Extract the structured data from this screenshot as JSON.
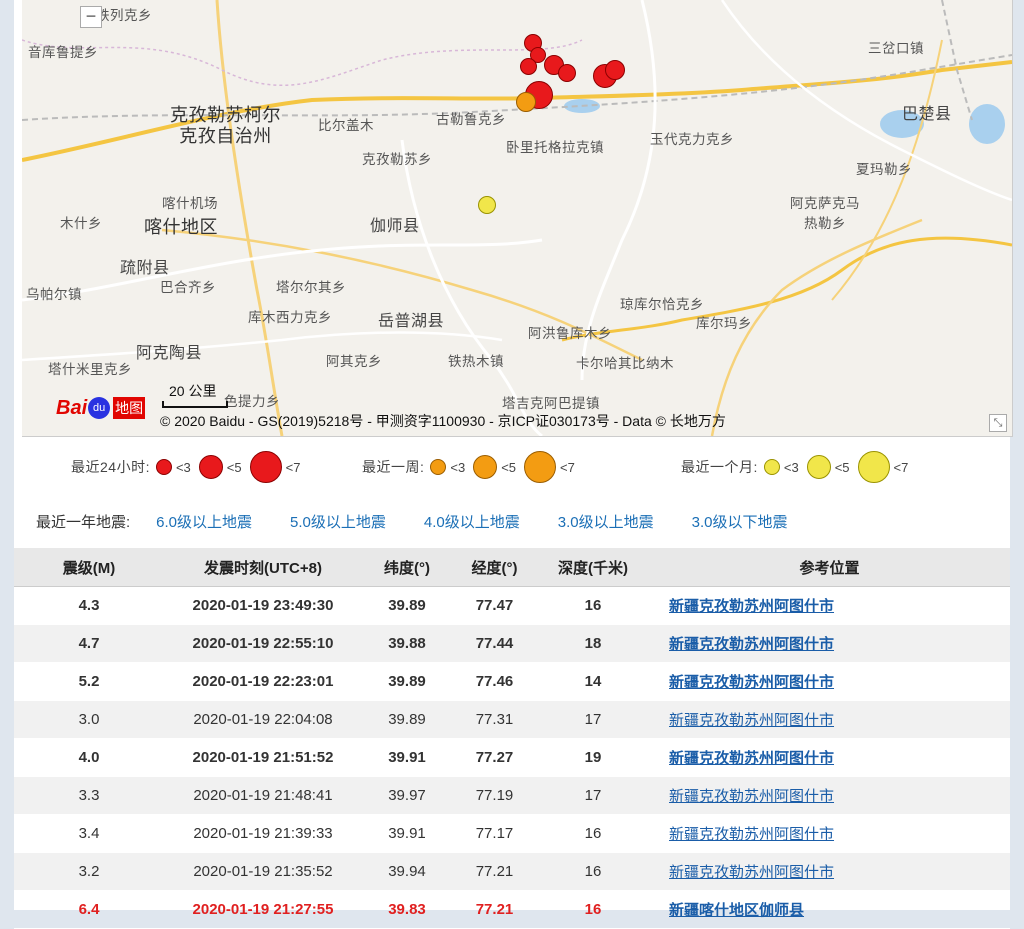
{
  "map": {
    "places": {
      "tieliekexiang": "铁列克乡",
      "yinkulutixiang": "音库鲁提乡",
      "kezhou_line1": "克孜勒苏柯尔",
      "kezhou_line2": "克孜自治州",
      "bierkaimu": "比尔盖木",
      "gulelukexiang": "古勒鲁克乡",
      "woli": "卧里托格拉克镇",
      "yudaikeli": "玉代克力克乡",
      "sanchakou": "三岔口镇",
      "bachu": "巴楚县",
      "kezilesu_xiang": "克孜勒苏乡",
      "xiamaleixiang": "夏玛勒乡",
      "kashijichang": "喀什机场",
      "mushixiang": "木什乡",
      "kashi": "喀什地区",
      "jiashi": "伽师县",
      "akesakema_line1": "阿克萨克马",
      "akesakema_line2": "热勒乡",
      "shufu": "疏附县",
      "bahezi": "巴合齐乡",
      "taerqi": "塔尔尔其乡",
      "wupaer": "乌帕尔镇",
      "qiongkuer": "琼库尔恰克乡",
      "kumuxi": "库木西力克乡",
      "yuepuhu": "岳普湖县",
      "akhonglu": "阿洪鲁库木乡",
      "kuermaxiang": "库尔玛乡",
      "akeaotao": "阿克陶县",
      "aqikexiang": "阿其克乡",
      "tiereimu": "铁热木镇",
      "kaerhaqi": "卡尔哈其比纳木",
      "tashimili": "塔什米里克乡",
      "selikexiang": "色提力乡",
      "tajiabati": "塔吉克阿巴提镇"
    },
    "scale_label": "20 公里",
    "logo_text": "Bai",
    "logo_paw": "du",
    "logo_map": "地图",
    "copyright": "© 2020 Baidu - GS(2019)5218号 - 甲测资字1100930 - 京ICP证030173号 - Data © 长地万方",
    "zoom_out": "−",
    "resize_glyph": "⤡"
  },
  "legend": {
    "day": {
      "title": "最近24小时:",
      "items": [
        "<3",
        "<5",
        "<7"
      ],
      "color": "#e8191c"
    },
    "week": {
      "title": "最近一周:",
      "items": [
        "<3",
        "<5",
        "<7"
      ],
      "color": "#f39c12"
    },
    "month": {
      "title": "最近一个月:",
      "items": [
        "<3",
        "<5",
        "<7"
      ],
      "color": "#f1e64a"
    }
  },
  "filters": {
    "label": "最近一年地震:",
    "links": [
      "6.0级以上地震",
      "5.0级以上地震",
      "4.0级以上地震",
      "3.0级以上地震",
      "3.0级以下地震"
    ]
  },
  "table": {
    "headers": [
      "震级(M)",
      "发震时刻(UTC+8)",
      "纬度(°)",
      "经度(°)",
      "深度(千米)",
      "参考位置"
    ],
    "rows": [
      {
        "mag": "4.3",
        "time": "2020-01-19 23:49:30",
        "lat": "39.89",
        "lon": "77.47",
        "depth": "16",
        "loc": "新疆克孜勒苏州阿图什市"
      },
      {
        "mag": "4.7",
        "time": "2020-01-19 22:55:10",
        "lat": "39.88",
        "lon": "77.44",
        "depth": "18",
        "loc": "新疆克孜勒苏州阿图什市"
      },
      {
        "mag": "5.2",
        "time": "2020-01-19 22:23:01",
        "lat": "39.89",
        "lon": "77.46",
        "depth": "14",
        "loc": "新疆克孜勒苏州阿图什市"
      },
      {
        "mag": "3.0",
        "time": "2020-01-19 22:04:08",
        "lat": "39.89",
        "lon": "77.31",
        "depth": "17",
        "loc": "新疆克孜勒苏州阿图什市"
      },
      {
        "mag": "4.0",
        "time": "2020-01-19 21:51:52",
        "lat": "39.91",
        "lon": "77.27",
        "depth": "19",
        "loc": "新疆克孜勒苏州阿图什市"
      },
      {
        "mag": "3.3",
        "time": "2020-01-19 21:48:41",
        "lat": "39.97",
        "lon": "77.19",
        "depth": "17",
        "loc": "新疆克孜勒苏州阿图什市"
      },
      {
        "mag": "3.4",
        "time": "2020-01-19 21:39:33",
        "lat": "39.91",
        "lon": "77.17",
        "depth": "16",
        "loc": "新疆克孜勒苏州阿图什市"
      },
      {
        "mag": "3.2",
        "time": "2020-01-19 21:35:52",
        "lat": "39.94",
        "lon": "77.21",
        "depth": "16",
        "loc": "新疆克孜勒苏州阿图什市"
      },
      {
        "mag": "6.4",
        "time": "2020-01-19 21:27:55",
        "lat": "39.83",
        "lon": "77.21",
        "depth": "16",
        "loc": "新疆喀什地区伽师县"
      }
    ]
  }
}
